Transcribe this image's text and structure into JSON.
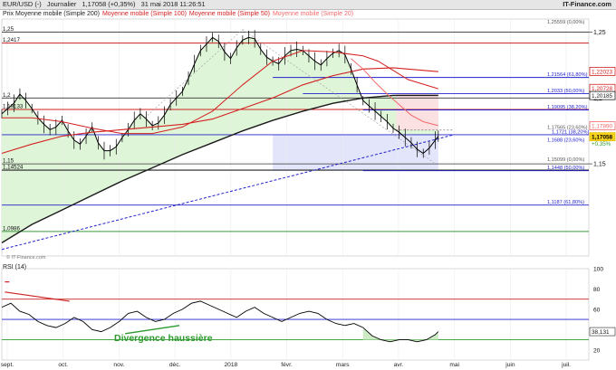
{
  "header": {
    "instrument": "EUR/USD (-)",
    "period": "Journalier",
    "price": "1,17058 (+0,35%)",
    "datetime": "31 mai 2018 11:26:51",
    "brand": "IT-Finance.com"
  },
  "legend": {
    "price_label": "Prix Moyenne mobile (Simple 200)",
    "ma100_label": "Moyenne mobile (Simple 100)",
    "ma50_label": "Moyenne mobile (Simple 50)",
    "ma20_label": "Moyenne mobile (Simple 20)"
  },
  "copyright": "© IT-Finance.com",
  "rsi": {
    "title": "RSI (14)",
    "current_value": "38,131",
    "annotation": "Divergence haussière"
  },
  "colors": {
    "ma200": "#1a1a1a",
    "ma100": "#d42020",
    "ma50": "#d42020",
    "ma20": "#f26a6a",
    "candles": "#000000",
    "fill_green": "#dff5d8",
    "fill_blue": "#e3e5fb",
    "fill_red": "#fbe1e1",
    "support_line": "#2222cc",
    "red_level": "#cc2222",
    "rsi_line": "#000000"
  },
  "chart_data": [
    {
      "type": "line",
      "title": "EUR/USD",
      "x_axis_labels": [
        "sept.",
        "oct.",
        "nov.",
        "déc.",
        "2018",
        "févr.",
        "mars",
        "avr.",
        "mai",
        "juin",
        "juil."
      ],
      "ylim": [
        1.08,
        1.26
      ],
      "y_ticks": [
        {
          "value": 1.25,
          "label": "1,25"
        },
        {
          "value": 1.2,
          "label": "1,2"
        },
        {
          "value": 1.15,
          "label": "1,15"
        }
      ],
      "left_levels": [
        {
          "value": 1.25,
          "label": "1,25"
        },
        {
          "value": 1.2417,
          "label": "1,2417"
        },
        {
          "value": 1.2,
          "label": "1,2"
        },
        {
          "value": 1.19133,
          "label": "1,19133"
        },
        {
          "value": 1.15,
          "label": "1,15"
        },
        {
          "value": 1.14524,
          "label": "1,14524"
        },
        {
          "value": 1.0986,
          "label": "1,0986"
        }
      ],
      "fibonacci_levels": [
        {
          "value": 1.2556,
          "label": "1,25559 (0,00%)"
        },
        {
          "value": 1.21564,
          "label": "1,21564 (61,80%)"
        },
        {
          "value": 1.2033,
          "label": "1,2033 (50,00%)"
        },
        {
          "value": 1.19095,
          "label": "1,19095 (38,20%)"
        },
        {
          "value": 1.17565,
          "label": "1,17565 (23,60%)"
        },
        {
          "value": 1.1721,
          "label": "1,1721 (38,20%)"
        },
        {
          "value": 1.1688,
          "label": "1,1688 (23,60%)"
        },
        {
          "value": 1.15099,
          "label": "1,15099 (0,00%)"
        },
        {
          "value": 1.1448,
          "label": "1,1448 (50,00%)"
        },
        {
          "value": 1.1187,
          "label": "1,1187 (61,80%)"
        }
      ],
      "right_badges": [
        {
          "value": 1.22023,
          "label": "1,22023",
          "color": "#d42020"
        },
        {
          "value": 1.20728,
          "label": "1,20728",
          "color": "#d42020"
        },
        {
          "value": 1.20185,
          "label": "1,20185",
          "color": "#1a1a1a"
        },
        {
          "value": 1.1789,
          "label": "1,17890",
          "color": "#f26a6a"
        },
        {
          "value": 1.17058,
          "label": "1,17058",
          "color": "#e5c000"
        }
      ],
      "change_label": "+0,35%",
      "series": [
        {
          "name": "EUR/USD",
          "x": [
            0,
            4,
            8,
            12,
            16,
            20,
            24,
            28,
            32,
            36,
            40,
            44,
            48,
            52,
            56,
            60,
            64,
            68,
            72,
            76,
            80,
            84,
            88,
            92,
            96,
            100,
            104,
            108,
            112,
            116,
            120,
            124,
            128,
            132,
            136,
            140,
            144,
            148,
            152,
            156,
            160,
            164,
            168,
            172,
            176,
            180,
            184,
            188,
            192,
            196,
            200,
            204,
            208,
            212,
            216,
            220,
            224,
            228,
            232,
            236,
            240,
            244,
            248,
            252,
            256,
            260,
            264,
            268,
            272,
            276,
            280,
            284,
            288,
            290
          ],
          "y": [
            1.188,
            1.192,
            1.196,
            1.203,
            1.198,
            1.192,
            1.185,
            1.18,
            1.176,
            1.178,
            1.183,
            1.175,
            1.168,
            1.165,
            1.171,
            1.178,
            1.166,
            1.16,
            1.16,
            1.163,
            1.17,
            1.176,
            1.183,
            1.188,
            1.184,
            1.179,
            1.181,
            1.187,
            1.195,
            1.2,
            1.205,
            1.215,
            1.226,
            1.236,
            1.241,
            1.246,
            1.243,
            1.235,
            1.23,
            1.238,
            1.244,
            1.246,
            1.245,
            1.237,
            1.231,
            1.228,
            1.226,
            1.232,
            1.236,
            1.237,
            1.236,
            1.232,
            1.228,
            1.225,
            1.23,
            1.234,
            1.236,
            1.233,
            1.222,
            1.21,
            1.198,
            1.194,
            1.19,
            1.186,
            1.182,
            1.177,
            1.174,
            1.17,
            1.166,
            1.161,
            1.158,
            1.162,
            1.168,
            1.171
          ]
        },
        {
          "name": "Moyenne mobile (Simple 200)",
          "x": [
            0,
            20,
            40,
            60,
            80,
            100,
            120,
            140,
            160,
            180,
            200,
            220,
            240,
            260,
            290
          ],
          "y": [
            1.09,
            1.104,
            1.115,
            1.126,
            1.137,
            1.147,
            1.157,
            1.166,
            1.175,
            1.183,
            1.19,
            1.196,
            1.2,
            1.202,
            1.202
          ]
        },
        {
          "name": "Moyenne mobile (Simple 100)",
          "x": [
            0,
            20,
            40,
            60,
            80,
            100,
            120,
            140,
            160,
            180,
            200,
            220,
            240,
            260,
            290
          ],
          "y": [
            1.158,
            1.165,
            1.171,
            1.174,
            1.176,
            1.178,
            1.18,
            1.184,
            1.192,
            1.2,
            1.21,
            1.217,
            1.222,
            1.223,
            1.22
          ]
        },
        {
          "name": "Moyenne mobile (Simple 50)",
          "x": [
            0,
            20,
            40,
            60,
            80,
            100,
            120,
            140,
            160,
            180,
            200,
            220,
            240,
            250,
            260,
            270,
            290
          ],
          "y": [
            1.185,
            1.185,
            1.182,
            1.177,
            1.173,
            1.173,
            1.178,
            1.19,
            1.21,
            1.228,
            1.236,
            1.235,
            1.232,
            1.228,
            1.221,
            1.214,
            1.207
          ]
        },
        {
          "name": "Moyenne mobile (Simple 20)",
          "x": [
            232,
            240,
            248,
            256,
            264,
            272,
            280,
            290
          ],
          "y": [
            1.23,
            1.222,
            1.212,
            1.203,
            1.195,
            1.187,
            1.182,
            1.179
          ]
        }
      ]
    },
    {
      "type": "line",
      "title": "RSI (14)",
      "ylim": [
        10,
        100
      ],
      "y_ticks": [
        {
          "value": 100,
          "label": "100"
        },
        {
          "value": 80,
          "label": "80"
        },
        {
          "value": 60,
          "label": "60"
        },
        {
          "value": 40,
          "label": "40"
        },
        {
          "value": 20,
          "label": "20"
        }
      ],
      "levels": [
        70,
        50,
        30
      ],
      "series": [
        {
          "name": "RSI",
          "x": [
            0,
            6,
            12,
            18,
            24,
            30,
            36,
            42,
            48,
            54,
            60,
            66,
            72,
            78,
            84,
            90,
            96,
            102,
            108,
            114,
            120,
            126,
            132,
            138,
            144,
            150,
            156,
            162,
            168,
            174,
            180,
            186,
            192,
            198,
            204,
            210,
            216,
            222,
            228,
            234,
            240,
            246,
            252,
            258,
            264,
            270,
            276,
            282,
            288,
            290
          ],
          "y": [
            62,
            66,
            58,
            55,
            48,
            44,
            42,
            46,
            52,
            48,
            40,
            38,
            42,
            48,
            56,
            58,
            52,
            48,
            50,
            56,
            60,
            66,
            68,
            64,
            60,
            56,
            52,
            58,
            62,
            56,
            52,
            48,
            52,
            56,
            58,
            56,
            50,
            46,
            44,
            46,
            42,
            34,
            30,
            28,
            30,
            30,
            28,
            30,
            35,
            38
          ]
        }
      ]
    }
  ]
}
